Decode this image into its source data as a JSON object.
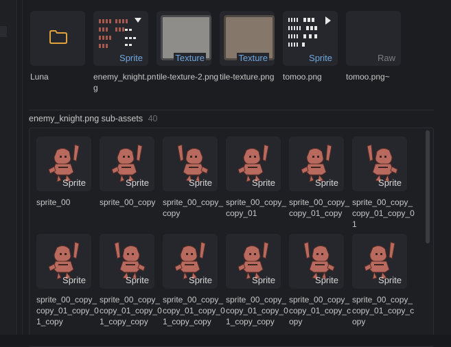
{
  "assets": [
    {
      "label": "Luna",
      "kind": "folder",
      "badge": ""
    },
    {
      "label": "enemy_knight.png",
      "kind": "sprite-sheet",
      "badge": "Sprite"
    },
    {
      "label": "tile-texture-2.png",
      "kind": "texture",
      "badge": "Texture"
    },
    {
      "label": "tile-texture.png",
      "kind": "texture",
      "badge": "Texture"
    },
    {
      "label": "tomoo.png",
      "kind": "sprite-sheet",
      "badge": "Sprite"
    },
    {
      "label": "tomoo.png~",
      "kind": "raw",
      "badge": "Raw"
    }
  ],
  "sub_assets": {
    "title": "enemy_knight.png  sub-assets",
    "count": "40",
    "rows": [
      [
        {
          "label": "sprite_00",
          "badge": "Sprite"
        },
        {
          "label": "sprite_00_copy",
          "badge": "Sprite"
        },
        {
          "label": "sprite_00_copy_copy",
          "badge": "Sprite"
        },
        {
          "label": "sprite_00_copy_copy_01",
          "badge": "Sprite"
        },
        {
          "label": "sprite_00_copy_copy_01_copy",
          "badge": "Sprite"
        },
        {
          "label": "sprite_00_copy_copy_01_copy_01",
          "badge": "Sprite"
        }
      ],
      [
        {
          "label": "sprite_00_copy_copy_01_copy_01_copy",
          "badge": "Sprite"
        },
        {
          "label": "sprite_00_copy_copy_01_copy_01_copy_copy",
          "badge": "Sprite"
        },
        {
          "label": "sprite_00_copy_copy_01_copy_01_copy_copy",
          "badge": "Sprite"
        },
        {
          "label": "sprite_00_copy_copy_01_copy_01_copy_copy",
          "badge": "Sprite"
        },
        {
          "label": "sprite_00_copy_copy_01_copy_copy",
          "badge": "Sprite"
        },
        {
          "label": "sprite_00_copy_copy_01_copy_copy",
          "badge": "Sprite"
        }
      ]
    ]
  },
  "colors": {
    "background": "#1b1c20",
    "tile": "#26272c",
    "badge_blue": "#6fa8e0",
    "folder": "#e0a23a",
    "knight": "#b86a5e"
  }
}
